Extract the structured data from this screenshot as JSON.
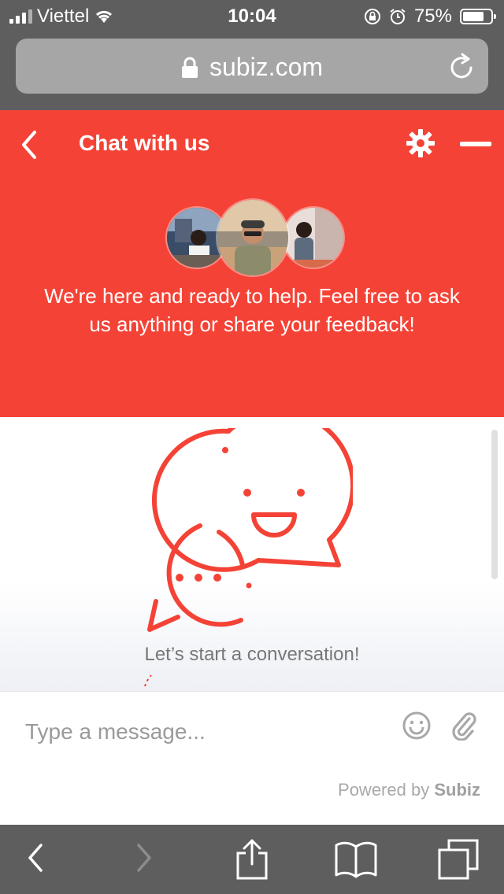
{
  "status_bar": {
    "carrier": "Viettel",
    "time": "10:04",
    "battery": "75%",
    "battery_level": 0.75
  },
  "browser": {
    "url": "subiz.com"
  },
  "chat": {
    "title": "Chat with us",
    "welcome": "We're here and ready to help. Feel free to ask us anything or share your feedback!",
    "start_prompt": "Let’s start a conversation!",
    "input_placeholder": "Type a message...",
    "powered_by": "Powered by",
    "brand": "Subiz"
  },
  "colors": {
    "accent": "#f44336",
    "chrome": "#5e5e5e"
  },
  "icons": [
    "signal-icon",
    "wifi-icon",
    "lock-icon",
    "alarm-icon",
    "reload-icon",
    "back-icon",
    "gear-icon",
    "minimize-icon",
    "emoji-icon",
    "attach-icon",
    "share-icon",
    "bookmarks-icon",
    "tabs-icon",
    "forward-icon"
  ]
}
